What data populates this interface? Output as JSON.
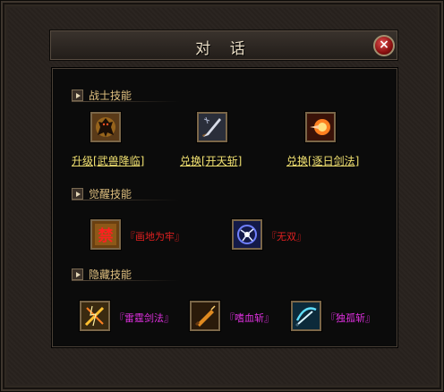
{
  "dialog": {
    "title": "对 话",
    "close_label": "×"
  },
  "sections": {
    "warrior": {
      "label": "战士技能"
    },
    "awaken": {
      "label": "觉醒技能"
    },
    "hidden": {
      "label": "隐藏技能"
    }
  },
  "warrior_skills": [
    {
      "label": "升级[武兽降临]",
      "icon": "beast-descend-icon"
    },
    {
      "label": "兑换[开天斩]",
      "icon": "sky-splitting-blade-icon"
    },
    {
      "label": "兑换[逐日剑法]",
      "icon": "sun-chasing-sword-icon"
    }
  ],
  "awaken_skills": [
    {
      "label": "『画地为牢』",
      "icon": "forbidden-seal-icon",
      "badge": "禁"
    },
    {
      "label": "『无双』",
      "icon": "unrivaled-icon"
    }
  ],
  "hidden_skills": [
    {
      "label": "『雷霆剑法』",
      "icon": "thunder-sword-icon"
    },
    {
      "label": "『嗜血斩』",
      "icon": "bloodthirsty-slash-icon"
    },
    {
      "label": "『独孤斩』",
      "icon": "lone-slash-icon"
    }
  ]
}
